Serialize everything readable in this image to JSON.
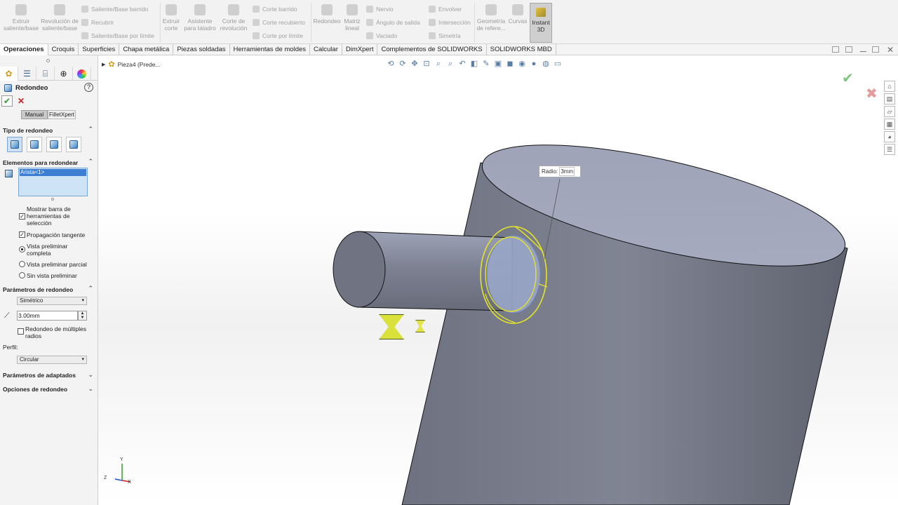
{
  "ribbon": {
    "big_buttons": [
      {
        "label": "Extruir saliente/base",
        "icon": "extrude-boss-icon"
      },
      {
        "label": "Revolución de saliente/base",
        "icon": "revolve-boss-icon"
      },
      {
        "label": "Extruir corte",
        "icon": "extrude-cut-icon"
      },
      {
        "label": "Asistente para taladro",
        "icon": "hole-wizard-icon"
      },
      {
        "label": "Corte de revolución",
        "icon": "revolve-cut-icon"
      },
      {
        "label": "Redondeo",
        "icon": "fillet-icon"
      },
      {
        "label": "Matriz lineal",
        "icon": "linear-pattern-icon"
      },
      {
        "label": "Geometría de refere...",
        "icon": "reference-geometry-icon"
      },
      {
        "label": "Curvas",
        "icon": "curves-icon"
      },
      {
        "label": "Instant 3D",
        "icon": "instant3d-icon"
      }
    ],
    "small_buttons": [
      "Saliente/Base barrido",
      "Recubrir",
      "Saliente/Base por límite",
      "Corte barrido",
      "Corte recubierto",
      "Corte por límite",
      "Nervio",
      "Ángulo de salida",
      "Vaciado",
      "Envolver",
      "Intersección",
      "Simetría"
    ]
  },
  "tabs": [
    "Operaciones",
    "Croquis",
    "Superficies",
    "Chapa metálica",
    "Piezas soldadas",
    "Herramientas de moldes",
    "Calcular",
    "DimXpert",
    "Complementos de SOLIDWORKS",
    "SOLIDWORKS MBD"
  ],
  "panel": {
    "title": "Redondeo",
    "help": "?",
    "mode_tabs": [
      "Manual",
      "FilletXpert"
    ],
    "sections": {
      "fillet_type": "Tipo de redondeo",
      "items_to_fillet": "Elementos para redondear",
      "fillet_params": "Parámetros de redondeo",
      "setback_params": "Parámetros de adaptados",
      "fillet_options": "Opciones de redondeo"
    },
    "selection_item": "Arista<1>",
    "checkboxes": {
      "show_toolbar": "Mostrar barra de herramientas de selección",
      "tangent": "Propagación tangente",
      "multi_radius": "Redondeo de múltiples radios"
    },
    "radios": {
      "full": "Vista preliminar completa",
      "partial": "Vista preliminar parcial",
      "none": "Sin vista preliminar"
    },
    "symmetric": "Simétrico",
    "radius_value": "3.00mm",
    "profile_label": "Perfil:",
    "profile_value": "Circular"
  },
  "viewport": {
    "breadcrumb": "Pieza4  (Prede...",
    "callout_label": "Radio:",
    "callout_value": "3mm"
  },
  "axes": {
    "y": "Y",
    "z": "Z",
    "x": "X"
  }
}
